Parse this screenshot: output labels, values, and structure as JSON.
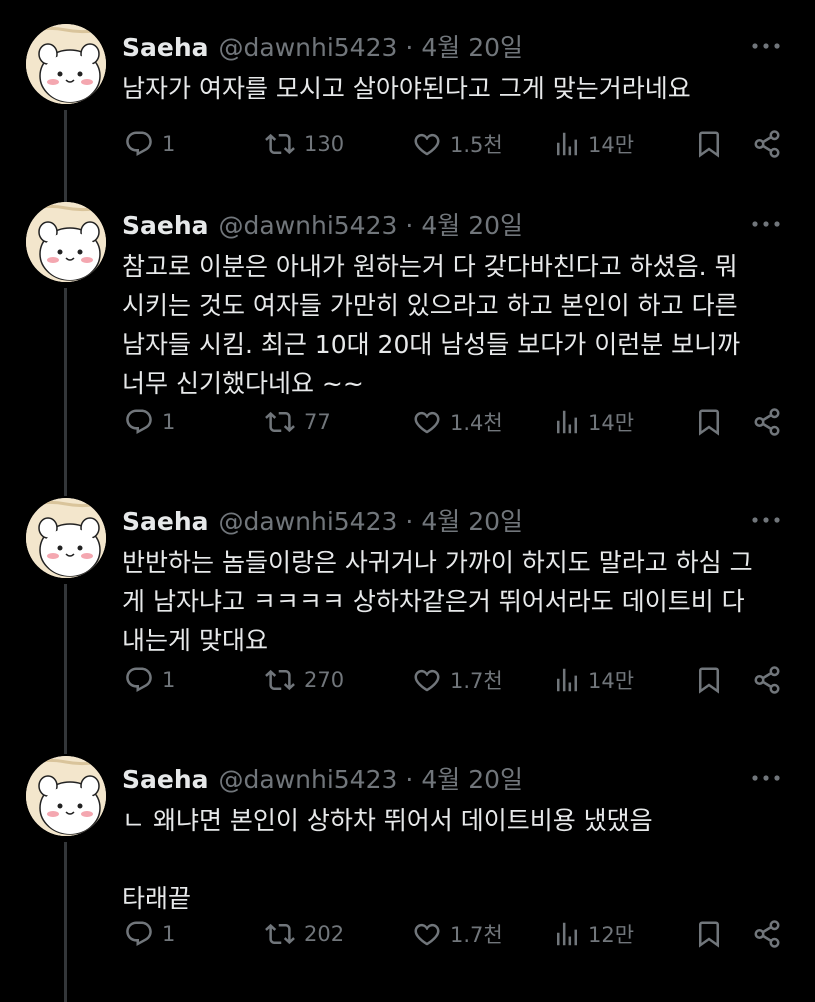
{
  "tweets": [
    {
      "name": "Saeha",
      "handle": "@dawnhi5423",
      "separator": "·",
      "date": "4월 20일",
      "text": "남자가 여자를 모시고 살아야된다고 그게 맞는거라네요",
      "replies": "1",
      "retweets": "130",
      "likes": "1.5천",
      "views": "14만"
    },
    {
      "name": "Saeha",
      "handle": "@dawnhi5423",
      "separator": "·",
      "date": "4월 20일",
      "text": "참고로 이분은 아내가 원하는거 다 갖다바친다고 하셨음. 뭐\n시키는 것도 여자들 가만히 있으라고 하고 본인이 하고 다른\n남자들 시킴. 최근 10대 20대 남성들 보다가 이런분 보니까\n너무 신기했다네요 ~~",
      "replies": "1",
      "retweets": "77",
      "likes": "1.4천",
      "views": "14만"
    },
    {
      "name": "Saeha",
      "handle": "@dawnhi5423",
      "separator": "·",
      "date": "4월 20일",
      "text": "반반하는 놈들이랑은 사귀거나 가까이 하지도 말라고 하심 그\n게 남자냐고 ㅋㅋㅋㅋ 상하차같은거 뛰어서라도 데이트비 다\n내는게 맞대요",
      "replies": "1",
      "retweets": "270",
      "likes": "1.7천",
      "views": "14만"
    },
    {
      "name": "Saeha",
      "handle": "@dawnhi5423",
      "separator": "·",
      "date": "4월 20일",
      "text": "ㄴ 왜냐면 본인이 상하차 뛰어서 데이트비용 냈댔음\n\n타래끝",
      "replies": "1",
      "retweets": "202",
      "likes": "1.7천",
      "views": "12만"
    }
  ],
  "icons": {
    "reply": "reply-icon",
    "retweet": "retweet-icon",
    "like": "heart-icon",
    "views": "views-icon",
    "bookmark": "bookmark-icon",
    "share": "share-icon",
    "more": "more-icon"
  },
  "colors": {
    "background": "#000000",
    "text": "#e7e9ea",
    "muted": "#71767b",
    "thread_line": "#333639"
  }
}
